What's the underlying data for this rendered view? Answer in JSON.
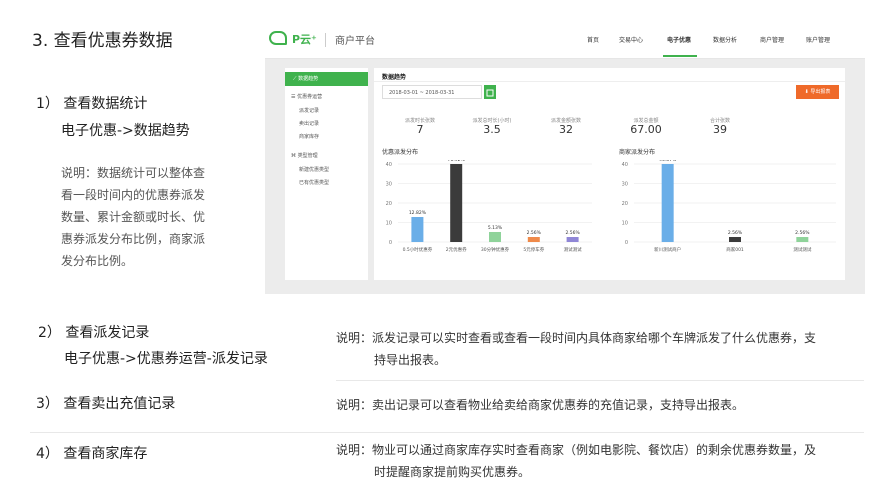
{
  "heading": "3. 查看优惠券数据",
  "step1": {
    "title": "1） 查看数据统计",
    "path": "电子优惠->数据趋势",
    "desc_lines": [
      "说明：数据统计可以整体查",
      "看一段时间内的优惠券派发",
      "数量、累计金额或时长、优",
      "惠券派发分布比例，商家派",
      "发分布比例。"
    ]
  },
  "screenshot": {
    "logo": "P云⁺",
    "platform": "商户平台",
    "nav": [
      "首页",
      "交易中心",
      "电子优惠",
      "数据分析",
      "商户管理",
      "账户管理"
    ],
    "sidebar": {
      "active": "数据趋势",
      "group1": "优惠券运营",
      "group1_items": [
        "派发记录",
        "卖出记录",
        "商家库存"
      ],
      "group2": "类型管理",
      "group2_items": [
        "新建优惠类型",
        "已有优惠类型"
      ]
    },
    "panel_title": "数据趋势",
    "date_range": "2018-03-01 ~ 2018-03-31",
    "export_label": "导出报表",
    "stats": [
      {
        "label": "派发时长张数",
        "value": "7"
      },
      {
        "label": "派发总时长(小时)",
        "value": "3.5"
      },
      {
        "label": "派发金额张数",
        "value": "32"
      },
      {
        "label": "派发总金额",
        "value": "67.00"
      },
      {
        "label": "合计张数",
        "value": "39"
      }
    ]
  },
  "chart_data": [
    {
      "type": "bar",
      "title": "优惠派发分布",
      "categories": [
        "0.5小时优惠券",
        "2元优惠券",
        "30分钟优惠券",
        "5元停车券",
        "测试测试"
      ],
      "values": [
        12.82,
        76.92,
        5.13,
        2.56,
        2.56
      ],
      "value_labels": [
        "12.82%",
        "76.92%",
        "5.13%",
        "2.56%",
        "2.56%"
      ],
      "bar_colors": [
        "#6aaee8",
        "#3b3b3b",
        "#8fd39a",
        "#ef8a4a",
        "#8f86d6"
      ],
      "ylim": [
        0,
        40
      ],
      "yticks": [
        "0",
        "10",
        "20",
        "30",
        "40"
      ]
    },
    {
      "type": "bar",
      "title": "商家派发分布",
      "categories": [
        "新川测试商户",
        "商家001",
        "测试测试"
      ],
      "values": [
        94.87,
        2.56,
        2.56
      ],
      "value_labels": [
        "94.87%",
        "2.56%",
        "2.56%"
      ],
      "bar_colors": [
        "#6aaee8",
        "#3b3b3b",
        "#8fd39a"
      ],
      "ylim": [
        0,
        40
      ],
      "yticks": [
        "0",
        "10",
        "20",
        "30",
        "40"
      ]
    }
  ],
  "step2": {
    "title": "2） 查看派发记录",
    "path": "电子优惠->优惠券运营-派发记录",
    "desc_lines": [
      "说明：派发记录可以实时查看或查看一段时间内具体商家给哪个车牌派发了什么优惠券，支",
      "持导出报表。"
    ]
  },
  "step3": {
    "title": "3） 查看卖出充值记录",
    "desc_lines": [
      "说明：卖出记录可以查看物业给卖给商家优惠券的充值记录，支持导出报表。"
    ]
  },
  "step4": {
    "title": "4） 查看商家库存",
    "desc_lines": [
      "说明：物业可以通过商家库存实时查看商家（例如电影院、餐饮店）的剩余优惠券数量，及",
      "时提醒商家提前购买优惠券。"
    ]
  }
}
